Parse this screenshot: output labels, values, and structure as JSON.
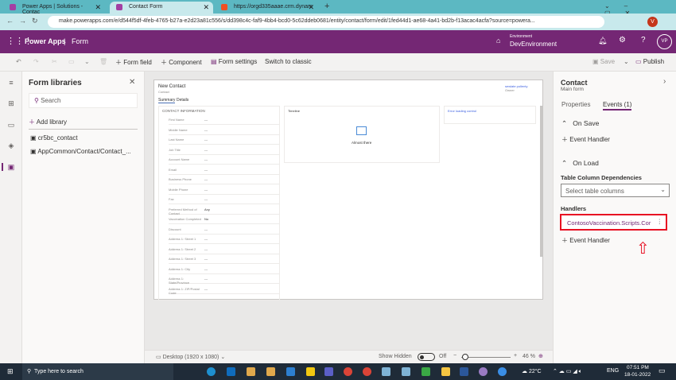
{
  "browser": {
    "tabs": [
      {
        "label": "Power Apps | Solutions - Contac"
      },
      {
        "label": "Contact Form"
      },
      {
        "label": "https://orgd335aaae.crm.dynam"
      }
    ],
    "url": "make.powerapps.com/e/d544f5df-4feb-4765-b27a-e2d23a81c556/s/dd398c4c-faf9-4bb4-bcd0-5c62ddeb0681/entity/contact/form/edit/1fed44d1-ae68-4a41-bd2b-f13acac4acfa?source=powera...",
    "profile": "V"
  },
  "header": {
    "app": "Power Apps",
    "separator": "|",
    "page": "Form",
    "env_label": "Environment",
    "env_name": "DevEnvironment",
    "avatar": "VP"
  },
  "toolbar": {
    "form_field": "Form field",
    "component": "Component",
    "form_settings": "Form settings",
    "switch_classic": "Switch to classic",
    "save": "Save",
    "publish": "Publish"
  },
  "libraries": {
    "title": "Form libraries",
    "search_placeholder": "Search",
    "add": "Add library",
    "items": [
      "cr5bc_contact",
      "AppCommon/Contact/Contact_..."
    ]
  },
  "form": {
    "title": "New Contact",
    "subtitle": "Contact",
    "tabs": [
      "Summary",
      "Details"
    ],
    "section": "CONTACT INFORMATION",
    "fields": [
      {
        "label": "First Name",
        "value": "---"
      },
      {
        "label": "Middle Name",
        "value": "---"
      },
      {
        "label": "Last Name",
        "value": "---"
      },
      {
        "label": "Job Title",
        "value": "---"
      },
      {
        "label": "Account Name",
        "value": "---"
      },
      {
        "label": "Email",
        "value": "---"
      },
      {
        "label": "Business Phone",
        "value": "---"
      },
      {
        "label": "Mobile Phone",
        "value": "---"
      },
      {
        "label": "Fax",
        "value": "---"
      },
      {
        "label": "Preferred Method of Contact",
        "value": "Any"
      },
      {
        "label": "Vaccination Completed",
        "value": "No"
      },
      {
        "label": "Discount",
        "value": "---"
      },
      {
        "label": "Address 1: Street 1",
        "value": "---"
      },
      {
        "label": "Address 1: Street 2",
        "value": "---"
      },
      {
        "label": "Address 1: Street 3",
        "value": "---"
      },
      {
        "label": "Address 1: City",
        "value": "---"
      },
      {
        "label": "Address 1: State/Province",
        "value": "---"
      },
      {
        "label": "Address 1: ZIP/Postal Code",
        "value": "---"
      }
    ],
    "timeline": "Timeline",
    "almost": "Almost there",
    "owner": "sewlate pollenty",
    "owner_sub": "Owner",
    "error": "Error loading control"
  },
  "panel": {
    "title": "Contact",
    "subtitle": "Main form",
    "tabs": [
      "Properties",
      "Events (1)"
    ],
    "on_save": "On Save",
    "event_handler": "Event Handler",
    "on_load": "On Load",
    "deps": "Table Column Dependencies",
    "deps_placeholder": "Select table columns",
    "handlers": "Handlers",
    "handler": "ContosoVaccination.Scripts.Cor"
  },
  "status": {
    "device": "Desktop (1920 x 1080)",
    "show_hidden": "Show Hidden",
    "toggle": "Off",
    "zoom": "46 %"
  },
  "taskbar": {
    "search": "Type here to search",
    "weather": "22°C",
    "lang": "ENG",
    "time": "07:51 PM",
    "date": "18-01-2022"
  }
}
